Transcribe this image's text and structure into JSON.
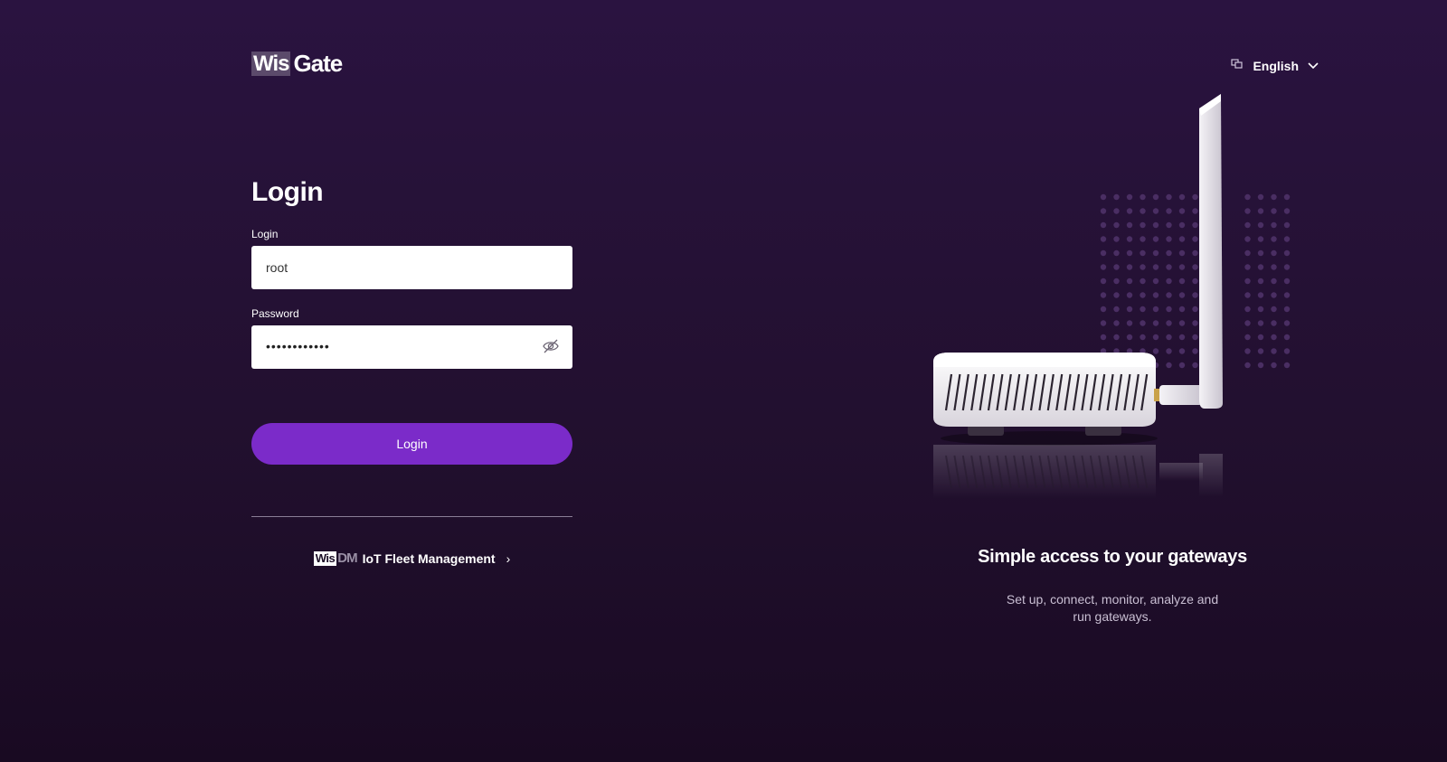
{
  "brand": {
    "wis": "Wis",
    "gate": "Gate"
  },
  "language": {
    "label": "English",
    "icon": "translate-icon",
    "chevron": "chevron-down-icon"
  },
  "login": {
    "title": "Login",
    "username_label": "Login",
    "username_value": "root",
    "password_label": "Password",
    "password_masked": "••••••••••••",
    "visibility_icon": "eye-off-icon",
    "submit_label": "Login"
  },
  "wisdm": {
    "wis": "Wis",
    "dm": "DM",
    "label": "IoT Fleet Management",
    "chevron": "›"
  },
  "hero": {
    "title": "Simple access to your gateways",
    "description": "Set up, connect, monitor, analyze and run gateways."
  },
  "colors": {
    "background": "#22102f",
    "accent": "#7b2bc9",
    "logo_block": "#5b4a6b"
  }
}
